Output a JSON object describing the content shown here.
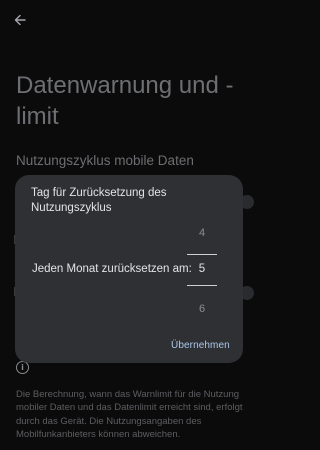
{
  "page": {
    "title": "Datenwarnung und -limit",
    "section_header": "Nutzungszyklus mobile Daten",
    "footer_text": "Die Berechnung, wann das Warnlimit für die Nutzung mobiler Daten und das Datenlimit erreicht sind, erfolgt durch das Gerät. Die Nutzungsangaben des Mobilfunkanbieters können abweichen."
  },
  "dialog": {
    "title": "Tag für Zurücksetzung des Nutzungszyklus",
    "picker_label": "Jeden Monat zurücksetzen am:",
    "picker": {
      "previous": "4",
      "current": "5",
      "next": "6"
    },
    "confirm_label": "Übernehmen"
  },
  "icons": {
    "back": "arrow-left-icon",
    "info": "info-icon"
  },
  "colors": {
    "background": "#0b0b0c",
    "dialog": "#2f3033",
    "accent": "#a9c8ec"
  }
}
